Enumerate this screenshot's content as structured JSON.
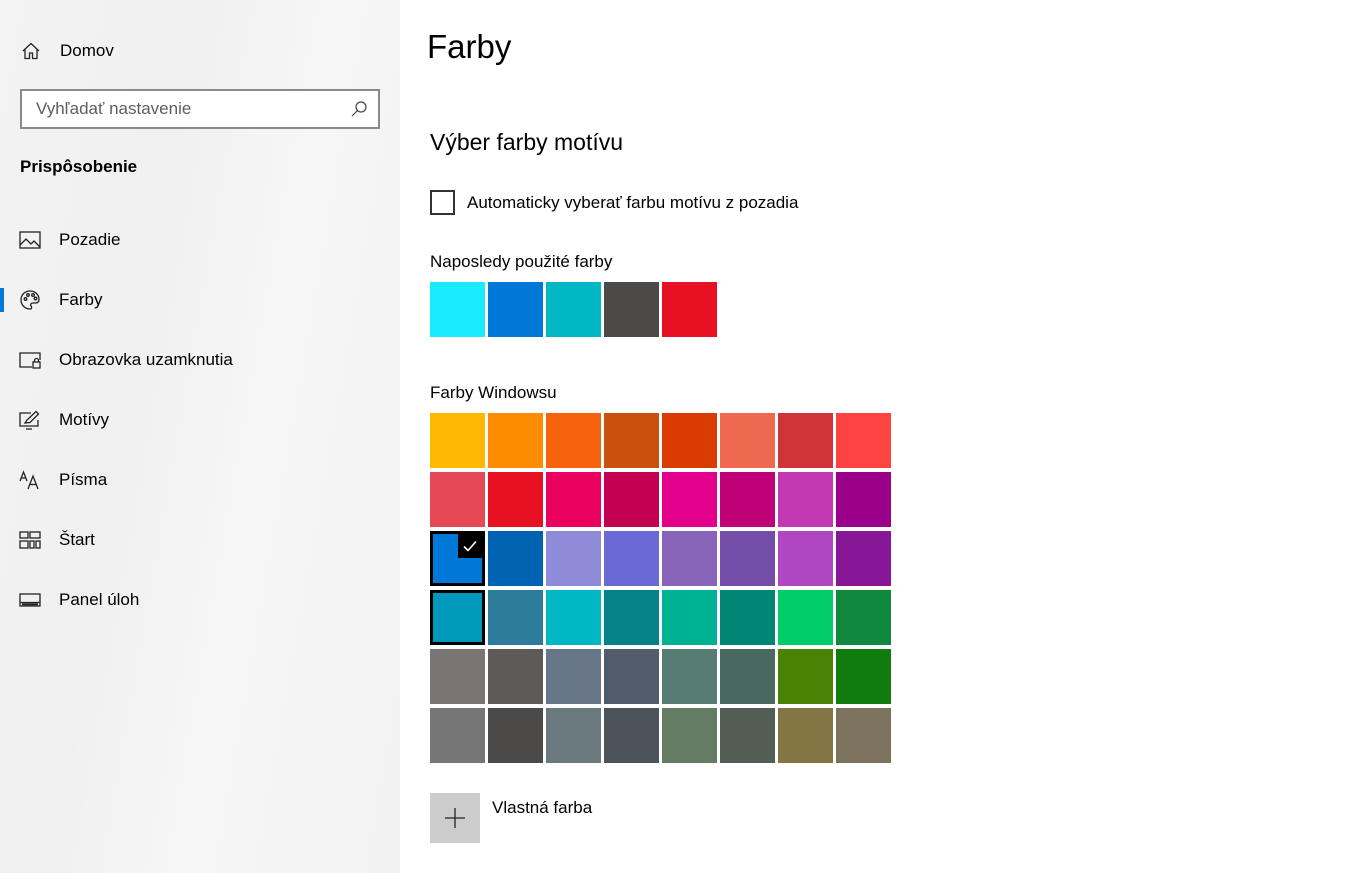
{
  "sidebar": {
    "home_label": "Domov",
    "search_placeholder": "Vyhľadať nastavenie",
    "section_title": "Prispôsobenie",
    "items": [
      {
        "label": "Pozadie",
        "icon": "picture-icon",
        "active": false
      },
      {
        "label": "Farby",
        "icon": "palette-icon",
        "active": true
      },
      {
        "label": "Obrazovka uzamknutia",
        "icon": "lock-screen-icon",
        "active": false
      },
      {
        "label": "Motívy",
        "icon": "themes-icon",
        "active": false
      },
      {
        "label": "Písma",
        "icon": "fonts-icon",
        "active": false
      },
      {
        "label": "Štart",
        "icon": "start-icon",
        "active": false
      },
      {
        "label": "Panel úloh",
        "icon": "taskbar-icon",
        "active": false
      }
    ]
  },
  "main": {
    "title": "Farby",
    "subheading": "Výber farby motívu",
    "auto_checkbox_label": "Automaticky vyberať farbu motívu z pozadia",
    "auto_checkbox_checked": false,
    "recent_label": "Naposledy použité farby",
    "recent_colors": [
      "#1AEBFF",
      "#0078D7",
      "#00B7C3",
      "#4C4A48",
      "#E81123"
    ],
    "windows_label": "Farby Windowsu",
    "windows_colors": [
      [
        "#FFB900",
        "#FF8C00",
        "#F7630C",
        "#CA5010",
        "#DA3B01",
        "#EF6950",
        "#D13438",
        "#FF4343"
      ],
      [
        "#E74856",
        "#E81123",
        "#EA005E",
        "#C30052",
        "#E3008C",
        "#BF0077",
        "#C239B3",
        "#9A0089"
      ],
      [
        "#0078D7",
        "#0063B1",
        "#8E8CD8",
        "#6B69D6",
        "#8764B8",
        "#744DA9",
        "#B146C2",
        "#881798"
      ],
      [
        "#0099BC",
        "#2D7D9A",
        "#00B7C3",
        "#038387",
        "#00B294",
        "#018574",
        "#00CC6A",
        "#10893E"
      ],
      [
        "#7A7574",
        "#5D5A58",
        "#68768A",
        "#515C6B",
        "#567C73",
        "#486860",
        "#498205",
        "#107C10"
      ],
      [
        "#767676",
        "#4C4A48",
        "#69797E",
        "#4A5459",
        "#647C64",
        "#525E54",
        "#847545",
        "#7E735F"
      ]
    ],
    "selected_color": "#0078D7",
    "custom_color_label": "Vlastná farba"
  }
}
